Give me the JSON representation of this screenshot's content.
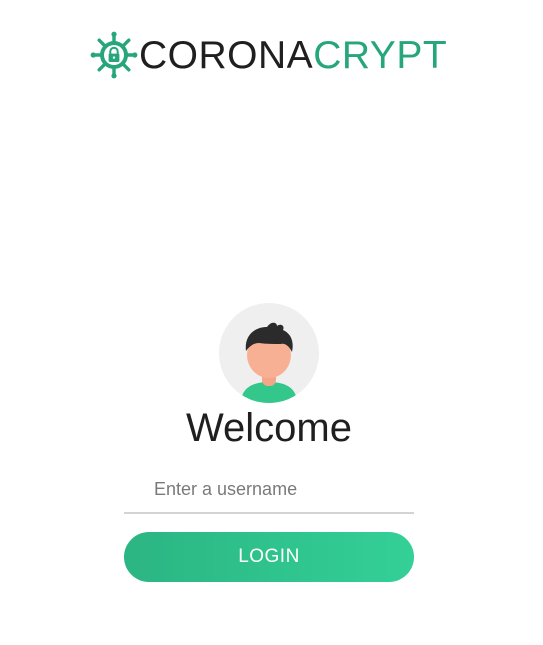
{
  "brand": {
    "name_part1": "CORONA",
    "name_part2": "CRYPT",
    "icon": "virus-lock-icon",
    "accent_color": "#27a57b"
  },
  "login": {
    "avatar_icon": "user-avatar-icon",
    "heading": "Welcome",
    "username_placeholder": "Enter a username",
    "username_value": "",
    "button_label": "LOGIN",
    "button_color": "#2fc48d"
  }
}
